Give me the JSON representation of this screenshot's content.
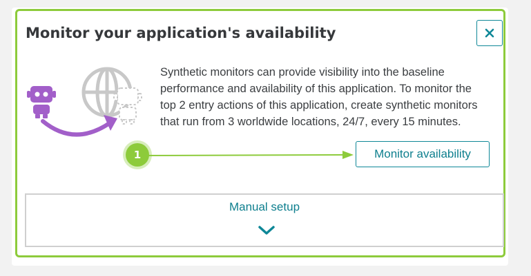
{
  "dialog": {
    "title": "Monitor your application's availability",
    "description": "Synthetic monitors can provide visibility into the baseline performance and availability of this application. To monitor the top 2 entry actions of this application, create synthetic monitors that run from 3 worldwide locations, 24/7, every 15 minutes.",
    "close_icon": "close-icon",
    "step_number": "1",
    "monitor_button_label": "Monitor availability",
    "manual_setup_label": "Manual setup",
    "expand_icon": "chevron-down-icon"
  },
  "colors": {
    "highlight": "#8dcb3b",
    "accent": "#0e8797",
    "robot": "#a25fc9"
  }
}
